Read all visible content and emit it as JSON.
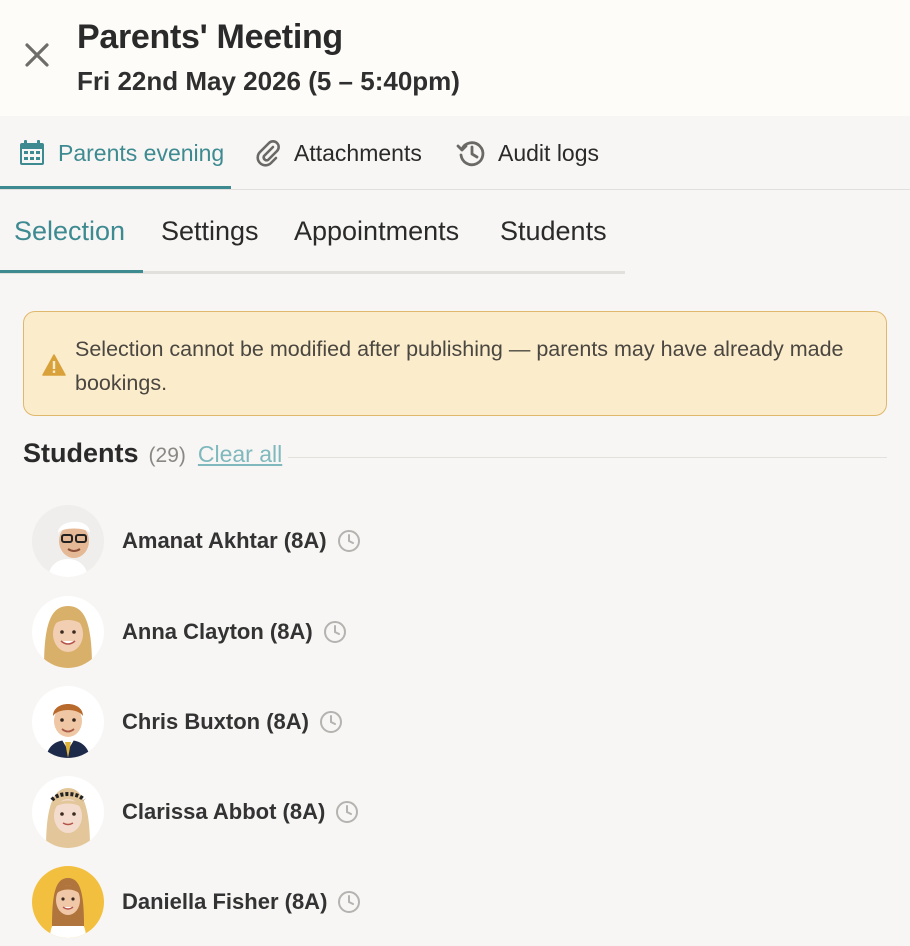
{
  "header": {
    "title": "Parents' Meeting",
    "subtitle": "Fri 22nd May 2026 (5 – 5:40pm)"
  },
  "primary_tabs": [
    {
      "label": "Parents evening",
      "icon": "calendar-icon",
      "active": true
    },
    {
      "label": "Attachments",
      "icon": "paperclip-icon",
      "active": false
    },
    {
      "label": "Audit logs",
      "icon": "history-icon",
      "active": false
    }
  ],
  "secondary_tabs": [
    {
      "label": "Selection",
      "active": true
    },
    {
      "label": "Settings",
      "active": false
    },
    {
      "label": "Appointments",
      "active": false
    },
    {
      "label": "Students",
      "active": false
    }
  ],
  "alert": {
    "icon": "warning-icon",
    "text": "Selection cannot be modified after publishing — parents may have already made bookings."
  },
  "students": {
    "title": "Students",
    "count": "(29)",
    "clear_all": "Clear all",
    "items": [
      {
        "name": "Amanat Akhtar (8A)",
        "icon": "clock-icon"
      },
      {
        "name": "Anna Clayton (8A)",
        "icon": "clock-icon"
      },
      {
        "name": "Chris Buxton (8A)",
        "icon": "clock-icon"
      },
      {
        "name": "Clarissa Abbot (8A)",
        "icon": "clock-icon"
      },
      {
        "name": "Daniella Fisher (8A)",
        "icon": "clock-icon"
      }
    ]
  },
  "colors": {
    "accent": "#3e8a91",
    "alert_bg": "#fbeccc",
    "alert_border": "#e0b86c",
    "warning": "#d9a13a"
  }
}
